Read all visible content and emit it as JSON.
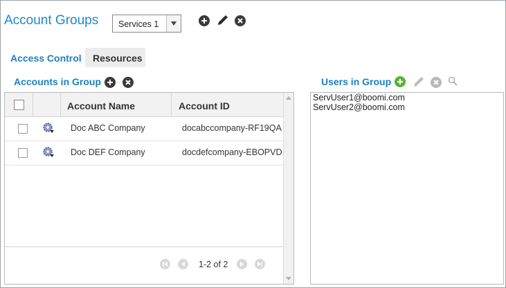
{
  "page": {
    "title": "Account Groups"
  },
  "group_select": {
    "value": "Services 1"
  },
  "tabs": [
    {
      "label": "Access Control"
    },
    {
      "label": "Resources"
    }
  ],
  "accounts": {
    "title": "Accounts in Group",
    "columns": [
      "Account Name",
      "Account ID"
    ],
    "rows": [
      {
        "name": "Doc ABC Company",
        "id": "docabccompany-RF19QA"
      },
      {
        "name": "Doc DEF Company",
        "id": "docdefcompany-EBOPVD"
      }
    ],
    "pager_text": "1-2 of 2"
  },
  "users": {
    "title": "Users in Group",
    "items": [
      "ServUser1@boomi.com",
      "ServUser2@boomi.com"
    ]
  },
  "colors": {
    "accent": "#1e88c7",
    "icon_dark": "#3a3a3a",
    "add_green": "#5ab136",
    "disabled": "#b5b5b5"
  }
}
